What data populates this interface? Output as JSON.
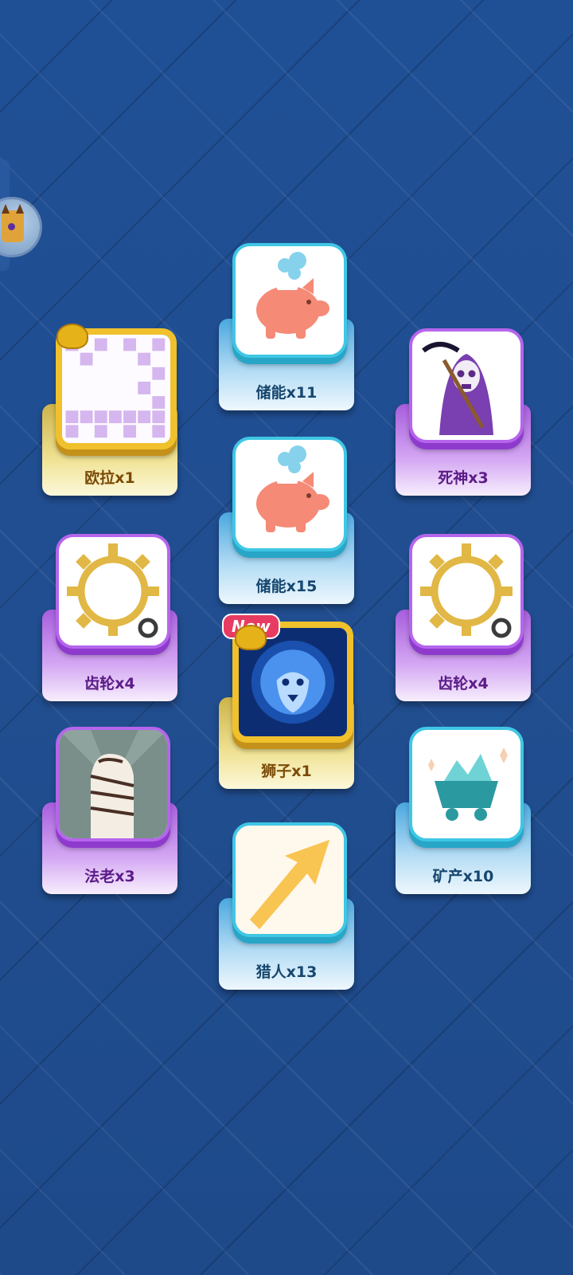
{
  "cards": [
    {
      "id": "piggy-11",
      "label": "储能x11",
      "icon": "piggy-bank-icon",
      "style": "blue"
    },
    {
      "id": "euler",
      "label": "欧拉x1",
      "icon": "grid-frame-icon",
      "style": "gold"
    },
    {
      "id": "reaper",
      "label": "死神x3",
      "icon": "grim-reaper-icon",
      "style": "purple"
    },
    {
      "id": "piggy-15",
      "label": "储能x15",
      "icon": "piggy-bank-icon",
      "style": "blue"
    },
    {
      "id": "gear-left",
      "label": "齿轮x4",
      "icon": "gear-icon",
      "style": "purple"
    },
    {
      "id": "gear-right",
      "label": "齿轮x4",
      "icon": "gear-icon",
      "style": "purple"
    },
    {
      "id": "lion",
      "label": "狮子x1",
      "icon": "lion-icon",
      "style": "gold",
      "badge": "New"
    },
    {
      "id": "pharaoh",
      "label": "法老x3",
      "icon": "mummy-hand-icon",
      "style": "purple"
    },
    {
      "id": "mine",
      "label": "矿产x10",
      "icon": "mine-cart-icon",
      "style": "blue"
    },
    {
      "id": "hunter",
      "label": "猎人x13",
      "icon": "arrow-icon",
      "style": "blue"
    }
  ],
  "colors": {
    "background": "#1f4f92",
    "cyan": "#3fc7e4",
    "violet": "#b565ec",
    "gold": "#f0c12c"
  }
}
